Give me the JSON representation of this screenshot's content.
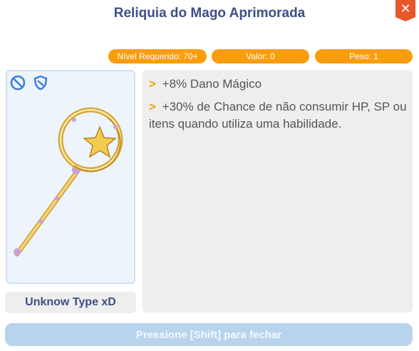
{
  "window": {
    "title": "Reliquia do Mago Aprimorada",
    "close_icon": "close-icon"
  },
  "stats": {
    "level": "Nível Requerido: 70+",
    "value": "Valor: 0",
    "weight": "Peso: 1"
  },
  "item": {
    "image": "staff-icon",
    "badges": [
      "no-trade-icon",
      "shield-icon"
    ],
    "type_label": "Unknow Type xD"
  },
  "description": {
    "bullet": ">",
    "lines": [
      "+8% Dano Mágico",
      "+30% de Chance de não consumir HP, SP ou itens quando utiliza uma habilidade."
    ]
  },
  "footer": {
    "close_hint": "Pressione [Shift] para fechar"
  },
  "colors": {
    "accent": "#f99d0f",
    "title": "#3d4f86",
    "close": "#e8562a",
    "footer": "#b7d4ec"
  }
}
